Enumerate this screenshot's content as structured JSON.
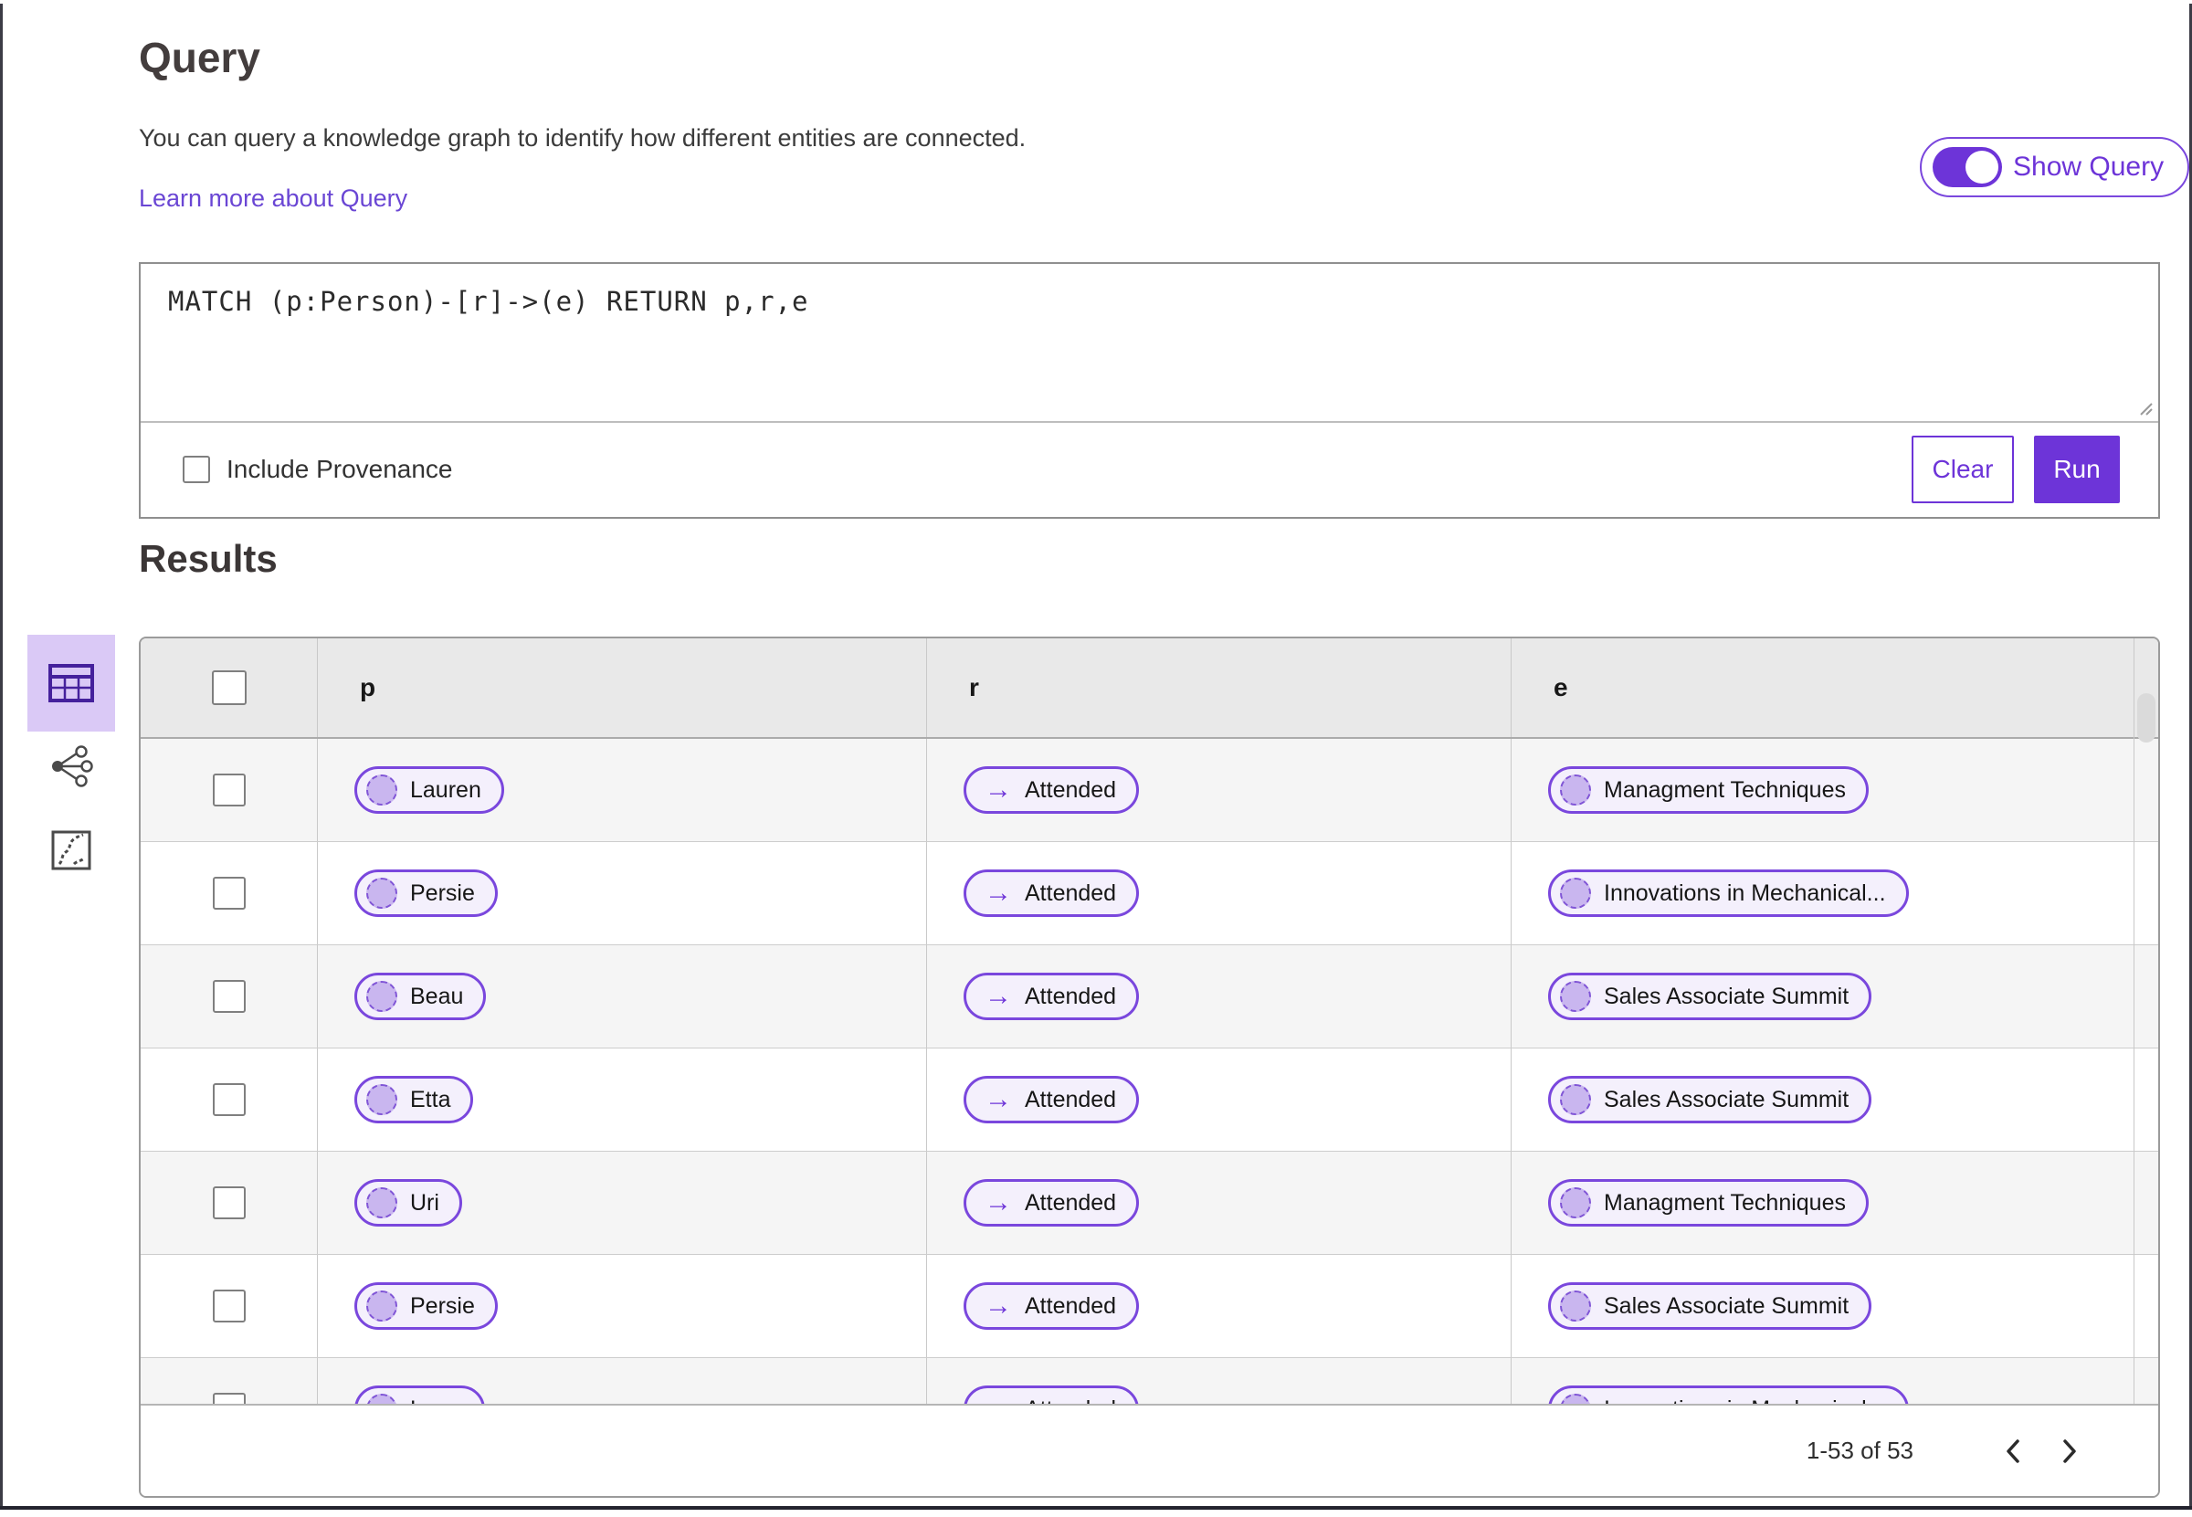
{
  "header": {
    "title": "Query",
    "description": "You can query a knowledge graph to identify how different entities are connected.",
    "learn_more_link": "Learn more about Query",
    "show_query_label": "Show Query",
    "show_query_on": true
  },
  "query_panel": {
    "query_text": "MATCH (p:Person)-[r]->(e) RETURN p,r,e",
    "include_provenance_label": "Include Provenance",
    "include_provenance_checked": false,
    "clear_label": "Clear",
    "run_label": "Run"
  },
  "sidebar": {
    "view_buttons": [
      {
        "icon": "table-icon",
        "selected": true
      },
      {
        "icon": "network-icon",
        "selected": false
      },
      {
        "icon": "path-icon",
        "selected": false
      }
    ]
  },
  "results": {
    "heading": "Results",
    "columns": [
      "p",
      "r",
      "e"
    ],
    "rows": [
      {
        "p": "Lauren",
        "r": "Attended",
        "e": "Managment Techniques"
      },
      {
        "p": "Persie",
        "r": "Attended",
        "e": "Innovations in Mechanical..."
      },
      {
        "p": "Beau",
        "r": "Attended",
        "e": "Sales Associate Summit"
      },
      {
        "p": "Etta",
        "r": "Attended",
        "e": "Sales Associate Summit"
      },
      {
        "p": "Uri",
        "r": "Attended",
        "e": "Managment Techniques"
      },
      {
        "p": "Persie",
        "r": "Attended",
        "e": "Sales Associate Summit"
      },
      {
        "p": "Larry",
        "r": "Attended",
        "e": "Innovations in Mechanical..."
      }
    ],
    "pagination": {
      "range_label": "1-53 of 53"
    }
  },
  "colors": {
    "accent_purple": "#6d34d8",
    "pill_border": "#7a47dd",
    "pill_background": "#f4f0fc",
    "node_fill": "#c9b6ef",
    "selected_view_background": "#dac9f6",
    "selected_view_icon": "#45219c",
    "header_row_background": "#e9e9e9",
    "alt_row_background": "#f5f5f5"
  }
}
